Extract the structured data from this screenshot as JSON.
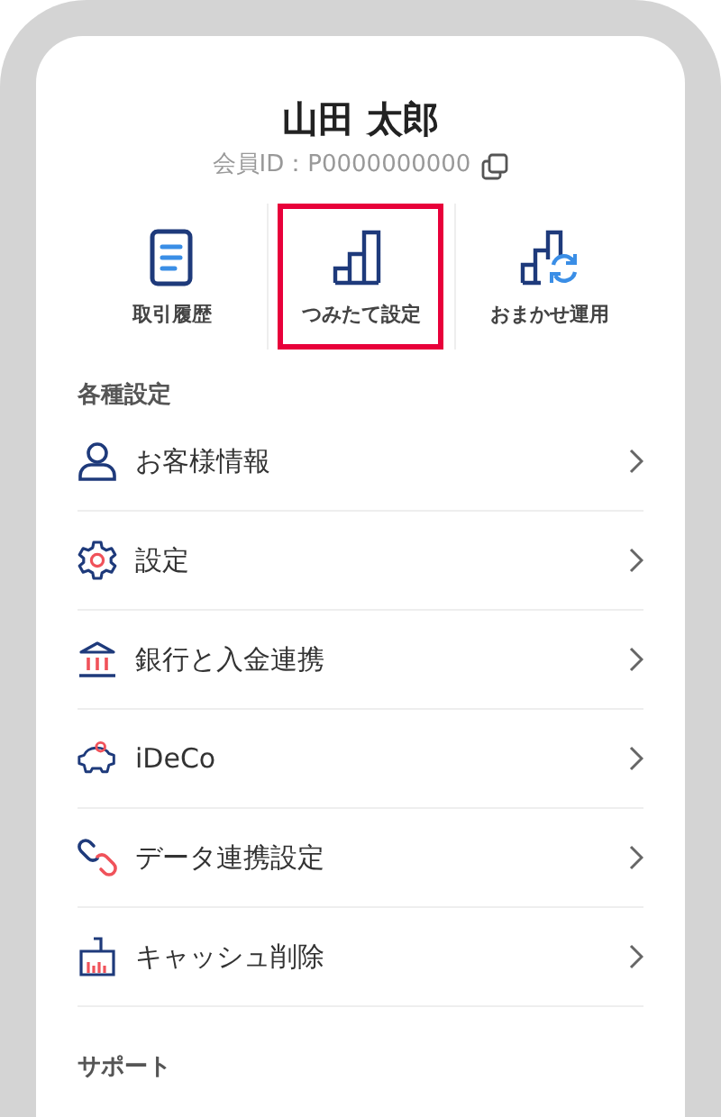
{
  "profile": {
    "name": "山田 太郎",
    "member_id": "会員ID：P0000000000"
  },
  "shortcuts": [
    {
      "label": "取引履歴",
      "selected": false
    },
    {
      "label": "つみたて設定",
      "selected": true
    },
    {
      "label": "おまかせ運用",
      "selected": false
    }
  ],
  "settings": {
    "heading": "各種設定",
    "items": [
      {
        "label": "お客様情報"
      },
      {
        "label": "設定"
      },
      {
        "label": "銀行と入金連携"
      },
      {
        "label": "iDeCo"
      },
      {
        "label": "データ連携設定"
      },
      {
        "label": "キャッシュ削除"
      }
    ]
  },
  "support": {
    "heading": "サポート"
  }
}
